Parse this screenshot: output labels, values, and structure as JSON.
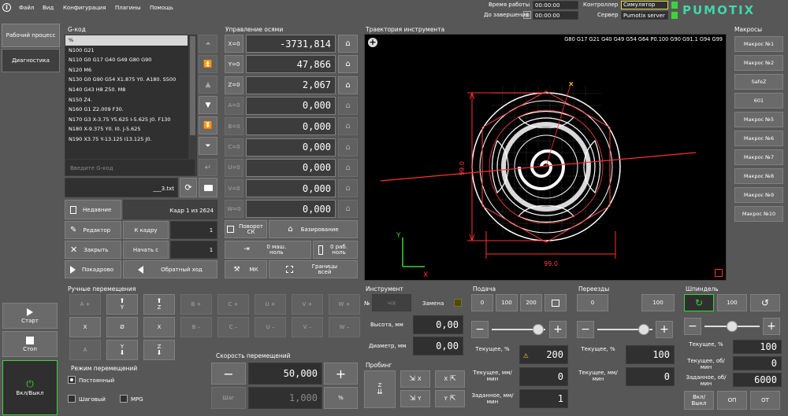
{
  "menu": {
    "file": "Файл",
    "view": "Вид",
    "config": "Конфигурация",
    "plugins": "Плагины",
    "help": "Помощь"
  },
  "header": {
    "work_time_label": "Время работы",
    "work_time": "00:00:00",
    "to_finish_label": "До завершения",
    "to_finish": "00:00:00",
    "controller_label": "Контроллер",
    "controller": "Симулятор",
    "server_label": "Сервер",
    "server": "Pumotix server",
    "logo": "PUMOTIX"
  },
  "nav": {
    "work": "Рабочий процесс",
    "diag": "Диагностика",
    "start": "Старт",
    "stop": "Стоп",
    "power": "Вкл/Выкл"
  },
  "gcode": {
    "title": "G-код",
    "lines": [
      "%",
      "N100 G21",
      "N110 G0 G17 G40 G49 G80 G90",
      "N120 M6",
      "N130 G0 G90 G54 X1.875 Y0. A180. S500",
      "N140 G43 H8 Z50. M8",
      "N150 Z4.",
      "N160 G1 Z2.009 F30.",
      "N170 G3 X-3.75 Y5.625 I-5.625 J0. F130",
      "N180 X-9.375 Y0. I0. J-5.625",
      "N190 X3.75 Y-13.125 I13.125 J0."
    ],
    "input_placeholder": "Введите G-код",
    "filename": "___3.txt",
    "recent": "Недавние",
    "frame_info": "Кадр 1 из 2624",
    "editor": "Редактор",
    "to_frame": "К кадру",
    "to_frame_val": "1",
    "close": "Закрыть",
    "start_from": "Начать с",
    "start_from_val": "1",
    "step": "Покадрово",
    "reverse": "Обратный ход"
  },
  "axes": {
    "title": "Управление осями",
    "items": [
      {
        "name": "X=0",
        "value": "-3731,814"
      },
      {
        "name": "Y=0",
        "value": "47,866"
      },
      {
        "name": "Z=0",
        "value": "2,067"
      },
      {
        "name": "A=0",
        "value": "0,000"
      },
      {
        "name": "B=0",
        "value": "0,000"
      },
      {
        "name": "C=0",
        "value": "0,000"
      },
      {
        "name": "U=0",
        "value": "0,000"
      },
      {
        "name": "V=0",
        "value": "0,000"
      },
      {
        "name": "W=0",
        "value": "0,000"
      }
    ],
    "rotate_sk": "Поворот СК",
    "homing": "Базирование",
    "zero_mach": "0 маш. ноль",
    "zero_work": "0 раб. ноль",
    "mk": "МК",
    "bounds": "Границы всей"
  },
  "trajectory": {
    "title": "Траектория инструмента",
    "gcodes": "G80 G17 G21 G40 G49 G54 G64 P0.100 G90 G91.1 G94 G99",
    "dim_v": "99.0",
    "dim_h": "99.0",
    "axis_x": "X",
    "axis_y": "Y"
  },
  "macros": {
    "title": "Макросы",
    "items": [
      "Макрос №1",
      "Макрос №2",
      "SafeZ",
      "601",
      "Макрос №5",
      "Макрос №6",
      "Макрос №7",
      "Макрос №8",
      "Макрос №9",
      "Макрос №10"
    ]
  },
  "jog": {
    "title": "Ручные перемещения",
    "row1": [
      "A +",
      "",
      "",
      "B +",
      "C +",
      "U +",
      "V +",
      "W +"
    ],
    "row2": [
      "X",
      "Ø",
      "X",
      "B –",
      "C –",
      "U –",
      "V –",
      "W –"
    ],
    "row3": [
      "A",
      "Y",
      "Z"
    ],
    "y_plus": "Y",
    "z_plus": "Z",
    "mode_title": "Режим перемещений",
    "mode_const": "Постоянный",
    "mode_step": "Шаговый",
    "mode_mpg": "MPG",
    "speed_title": "Скорость перемещений",
    "speed_val": "50,000",
    "step_label": "Шаг",
    "step_val": "1,000",
    "pct": "%"
  },
  "tool": {
    "title": "Инструмент",
    "num_label": "№",
    "num_placeholder": "н/д",
    "replace": "Замена",
    "height_label": "Высота, мм",
    "height": "0,00",
    "diam_label": "Диаметр, мм",
    "diam": "0,00"
  },
  "probing": {
    "title": "Пробинг",
    "x": "X",
    "y": "Y"
  },
  "feed": {
    "title": "Подача",
    "b0": "0",
    "b100": "100",
    "b200": "200",
    "current_label": "Текущее, %",
    "current": "200",
    "cur_mm_label": "Текущее, мм/мин",
    "cur_mm": "0",
    "set_label": "Заданное, мм/мин",
    "set": "1"
  },
  "rapid": {
    "title": "Переезды",
    "b0": "0",
    "b100": "100",
    "current_label": "Текущее, %",
    "current": "100",
    "cur_mm_label": "Текущее, мм/мин",
    "cur_mm": "0"
  },
  "spindle": {
    "title": "Шпиндель",
    "b100": "100",
    "current_label": "Текущее, %",
    "current": "100",
    "rpm_label": "Текущее, об/мин",
    "rpm": "0",
    "set_label": "Заданное, об/мин",
    "set": "6000",
    "onoff": "Вкл/Выкл",
    "on": "ОП",
    "off": "ОТ"
  },
  "colors": {
    "bg": "#575757",
    "accent_green": "#3cd33c",
    "logo": "#3fd7a8",
    "trajectory_bg": "#000000"
  }
}
